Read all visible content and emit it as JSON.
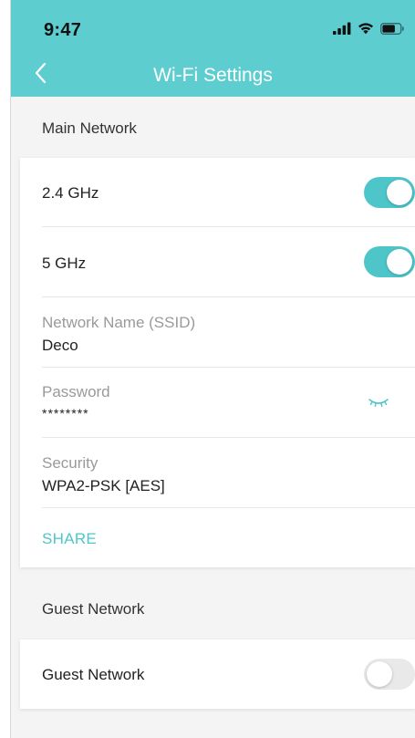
{
  "status_bar": {
    "time": "9:47",
    "signal_icon": "signal-bars-icon",
    "wifi_icon": "wifi-icon",
    "battery_icon": "battery-icon"
  },
  "header": {
    "back_icon": "chevron-left-icon",
    "title": "Wi-Fi Settings",
    "background_color": "#5dcdd0"
  },
  "main_network": {
    "section_label": "Main Network",
    "band_24": {
      "label": "2.4 GHz",
      "enabled": true
    },
    "band_5": {
      "label": "5 GHz",
      "enabled": true
    },
    "ssid": {
      "label": "Network Name (SSID)",
      "value": "Deco"
    },
    "password": {
      "label": "Password",
      "value": "********",
      "visibility_icon": "eye-closed-icon"
    },
    "security": {
      "label": "Security",
      "value": "WPA2-PSK [AES]"
    },
    "share_label": "SHARE"
  },
  "guest_network": {
    "section_label": "Guest Network",
    "toggle_label": "Guest Network",
    "enabled": false
  },
  "colors": {
    "accent": "#4ec6c9",
    "toggle_off": "#e9e9ea"
  }
}
